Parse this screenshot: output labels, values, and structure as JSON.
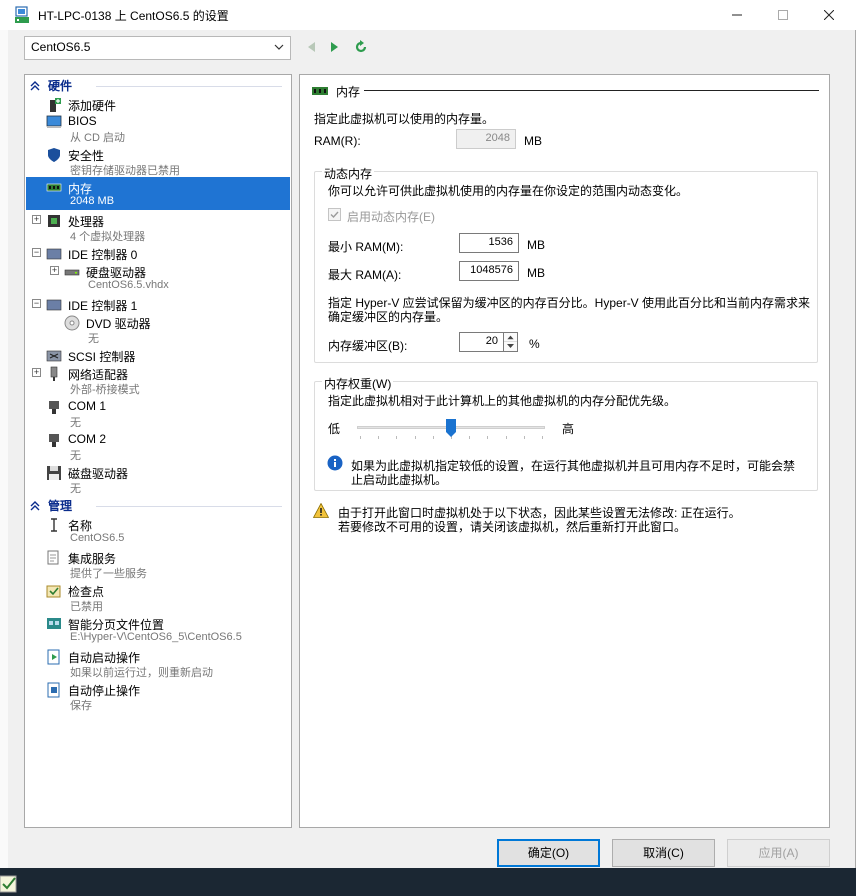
{
  "window": {
    "title": "HT-LPC-0138 上 CentOS6.5 的设置"
  },
  "vm_select": {
    "value": "CentOS6.5"
  },
  "tree": {
    "hardware_header": "硬件",
    "management_header": "管理",
    "items": [
      {
        "label": "添加硬件",
        "sub": ""
      },
      {
        "label": "BIOS",
        "sub": "从 CD 启动"
      },
      {
        "label": "安全性",
        "sub": "密钥存储驱动器已禁用"
      },
      {
        "label": "内存",
        "sub": "2048 MB"
      },
      {
        "label": "处理器",
        "sub": "4 个虚拟处理器"
      },
      {
        "label": "IDE 控制器 0",
        "sub": ""
      },
      {
        "label": "硬盘驱动器",
        "sub": "CentOS6.5.vhdx"
      },
      {
        "label": "IDE 控制器 1",
        "sub": ""
      },
      {
        "label": "DVD 驱动器",
        "sub": "无"
      },
      {
        "label": "SCSI 控制器",
        "sub": ""
      },
      {
        "label": "网络适配器",
        "sub": "外部-桥接模式"
      },
      {
        "label": "COM 1",
        "sub": "无"
      },
      {
        "label": "COM 2",
        "sub": "无"
      },
      {
        "label": "磁盘驱动器",
        "sub": "无"
      }
    ],
    "mgmt_items": [
      {
        "label": "名称",
        "sub": "CentOS6.5"
      },
      {
        "label": "集成服务",
        "sub": "提供了一些服务"
      },
      {
        "label": "检查点",
        "sub": "已禁用"
      },
      {
        "label": "智能分页文件位置",
        "sub": "E:\\Hyper-V\\CentOS6_5\\CentOS6.5"
      },
      {
        "label": "自动启动操作",
        "sub": "如果以前运行过，则重新启动"
      },
      {
        "label": "自动停止操作",
        "sub": "保存"
      }
    ]
  },
  "memory": {
    "header": "内存",
    "intro": "指定此虚拟机可以使用的内存量。",
    "ram_label": "RAM(R):",
    "ram_value": "2048",
    "unit_mb": "MB",
    "dynamic_title": "动态内存",
    "dynamic_desc": "你可以允许可供此虚拟机使用的内存量在你设定的范围内动态变化。",
    "enable_dynamic": "启用动态内存(E)",
    "min_label": "最小 RAM(M):",
    "min_value": "1536",
    "max_label": "最大 RAM(A):",
    "max_value": "1048576",
    "buffer_desc_1": "指定 Hyper-V 应尝试保留为缓冲区的内存百分比。Hyper-V 使用此百分比和当前内存需求来",
    "buffer_desc_2": "确定缓冲区的内存量。",
    "buffer_label": "内存缓冲区(B):",
    "buffer_value": "20",
    "percent": "%",
    "weight_title": "内存权重(W)",
    "weight_desc": "指定此虚拟机相对于此计算机上的其他虚拟机的内存分配优先级。",
    "low": "低",
    "high": "高",
    "weight_level": 0.5,
    "info_1": "如果为此虚拟机指定较低的设置，在运行其他虚拟机并且可用内存不足时，可能会禁",
    "info_2": "止启动此虚拟机。",
    "warn_1": "由于打开此窗口时虚拟机处于以下状态，因此某些设置无法修改: 正在运行。",
    "warn_2": "若要修改不可用的设置，请关闭该虚拟机，然后重新打开此窗口。"
  },
  "buttons": {
    "ok": "确定(O)",
    "cancel": "取消(C)",
    "apply": "应用(A)"
  },
  "colors": {
    "selection": "#1f74d3",
    "header": "#0a2c8c",
    "accent": "#0078d7"
  }
}
